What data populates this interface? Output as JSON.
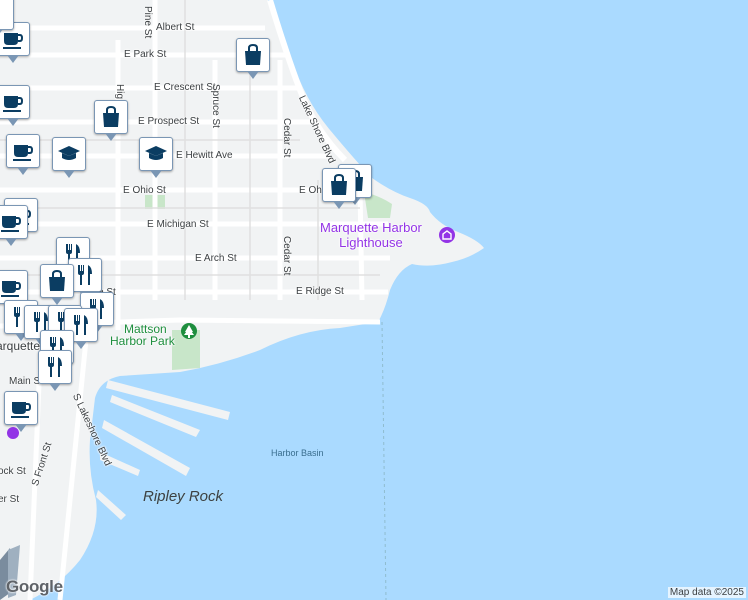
{
  "map": {
    "colors": {
      "water": "#aadaff",
      "land": "#f1f3f4",
      "park": "#c8e6c9",
      "road": "#ffffff",
      "poi": "#9334e6",
      "pin": "#0b3d62"
    },
    "streets": {
      "albert": "Albert St",
      "park": "E Park St",
      "crescent": "E Crescent St",
      "prospect": "E Prospect St",
      "hewitt": "E Hewitt Ave",
      "ohio": "E Ohio St",
      "ohio2": "E Ohi",
      "michigan": "E Michigan St",
      "arch": "E Arch St",
      "ridge": "E Ridge St",
      "ridge_left": "e St",
      "main": "Main S",
      "pine": "Pine St",
      "high": "Hig",
      "spruce": "Spruce St",
      "cedar": "Cedar St",
      "cedar2": "Cedar St",
      "lakeshore": "Lake Shore Blvd",
      "s_lakeshore": "S Lakeshore Blvd",
      "s_front": "S Front St",
      "rock": "ock St",
      "er": "er St"
    },
    "places": {
      "lighthouse": "Marquette Harbor\nLighthouse",
      "park_line1": "Mattson",
      "park_line2": "Harbor Park",
      "city": "arquette",
      "harbor_basin": "Harbor Basin",
      "ripley_rock": "Ripley Rock"
    },
    "pins": [
      {
        "icon": "coffee-icon"
      },
      {
        "icon": "shopping-bag-icon"
      },
      {
        "icon": "coffee-icon"
      },
      {
        "icon": "shopping-bag-icon"
      },
      {
        "icon": "coffee-icon"
      },
      {
        "icon": "school-icon"
      },
      {
        "icon": "school-icon"
      },
      {
        "icon": "shopping-bag-icon"
      },
      {
        "icon": "coffee-icon"
      },
      {
        "icon": "restaurant-icon"
      },
      {
        "icon": "shopping-bag-icon"
      },
      {
        "icon": "coffee-icon"
      },
      {
        "icon": "restaurant-icon"
      },
      {
        "icon": "restaurant-icon"
      },
      {
        "icon": "coffee-icon"
      }
    ],
    "logo": "Google",
    "attribution": "Map data ©2025"
  }
}
